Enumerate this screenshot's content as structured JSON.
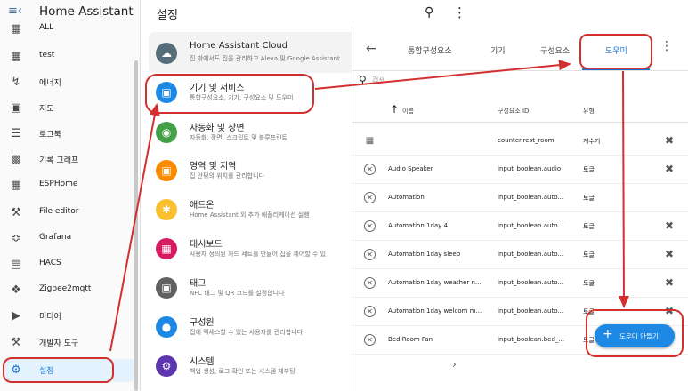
{
  "sidebar": {
    "title": "Home Assistant",
    "items": [
      {
        "label": "ALL",
        "icon": "grid-icon"
      },
      {
        "label": "test",
        "icon": "grid-icon"
      },
      {
        "label": "에너지",
        "icon": "lightning-icon"
      },
      {
        "label": "지도",
        "icon": "map-icon"
      },
      {
        "label": "로그북",
        "icon": "list-icon"
      },
      {
        "label": "기록 그래프",
        "icon": "chart-icon"
      },
      {
        "label": "ESPHome",
        "icon": "chip-icon"
      },
      {
        "label": "File editor",
        "icon": "wrench-icon"
      },
      {
        "label": "Grafana",
        "icon": "graph-icon"
      },
      {
        "label": "HACS",
        "icon": "store-icon"
      },
      {
        "label": "Zigbee2mqtt",
        "icon": "compass-icon"
      },
      {
        "label": "미디어",
        "icon": "play-icon"
      },
      {
        "label": "개발자 도구",
        "icon": "hammer-icon"
      },
      {
        "label": "설정",
        "icon": "gear-icon"
      }
    ]
  },
  "settings": {
    "title": "설정",
    "items": [
      {
        "title": "Home Assistant Cloud",
        "subtitle": "집 밖에서도 집을 관리하고 Alexa 및 Google Assistant",
        "color": "#546e7a",
        "icon": "cloud-icon"
      },
      {
        "title": "기기 및 서비스",
        "subtitle": "통합구성요소, 기기, 구성요소 및 도우미",
        "color": "#1e88e5",
        "icon": "devices-icon"
      },
      {
        "title": "자동화 및 장면",
        "subtitle": "자동화, 장면, 스크립트 및 블루프린트",
        "color": "#43a047",
        "icon": "robot-icon"
      },
      {
        "title": "영역 및 지역",
        "subtitle": "집 안팎의 위치를 관리합니다",
        "color": "#fb8c00",
        "icon": "sofa-icon"
      },
      {
        "title": "애드온",
        "subtitle": "Home Assistant 외 추가 애플리케이션 실행",
        "color": "#fbc02d",
        "icon": "puzzle-icon"
      },
      {
        "title": "대시보드",
        "subtitle": "사용자 정의된 카드 세트를 만들어 집을 제어할 수 있",
        "color": "#d81b60",
        "icon": "dashboard-icon"
      },
      {
        "title": "태그",
        "subtitle": "NFC 태그 및 QR 코드를 설정합니다",
        "color": "#616161",
        "icon": "tag-icon"
      },
      {
        "title": "구성원",
        "subtitle": "집에 액세스할 수 있는 사용자를 관리합니다",
        "color": "#1e88e5",
        "icon": "person-icon"
      },
      {
        "title": "시스템",
        "subtitle": "백업 생성, 로그 확인 또는 시스템 재부팅",
        "color": "#5e35b1",
        "icon": "gear-icon"
      }
    ]
  },
  "tabs": [
    "통합구성요소",
    "기기",
    "구성요소",
    "도우미"
  ],
  "search_placeholder": "검색",
  "table": {
    "headers": {
      "name": "이름",
      "entity_id": "구성요소 ID",
      "type": "유형"
    },
    "rows": [
      {
        "name": "",
        "entity_id": "counter.rest_room",
        "type": "계수기",
        "status_icon": "counter-icon"
      },
      {
        "name": "Audio Speaker",
        "entity_id": "input_boolean.audio",
        "type": "토글",
        "status_icon": "close-circle-icon"
      },
      {
        "name": "Automation",
        "entity_id": "input_boolean.auto...",
        "type": "토글",
        "status_icon": "close-circle-icon"
      },
      {
        "name": "Automation 1day 4",
        "entity_id": "input_boolean.auto...",
        "type": "토글",
        "status_icon": "close-circle-icon"
      },
      {
        "name": "Automation 1day sleep",
        "entity_id": "input_boolean.auto...",
        "type": "토글",
        "status_icon": "close-circle-icon"
      },
      {
        "name": "Automation 1day weather n...",
        "entity_id": "input_boolean.auto...",
        "type": "토글",
        "status_icon": "close-circle-icon"
      },
      {
        "name": "Automation 1day welcom m...",
        "entity_id": "input_boolean.auto...",
        "type": "토글",
        "status_icon": "close-circle-icon"
      },
      {
        "name": "Bed Room Fan",
        "entity_id": "input_boolean.bed_...",
        "type": "토글",
        "status_icon": "close-circle-icon"
      }
    ]
  },
  "fab": {
    "label": "도우미 만들기"
  },
  "colors": {
    "accent": "#1976d2",
    "annotation": "#d32f2f"
  }
}
